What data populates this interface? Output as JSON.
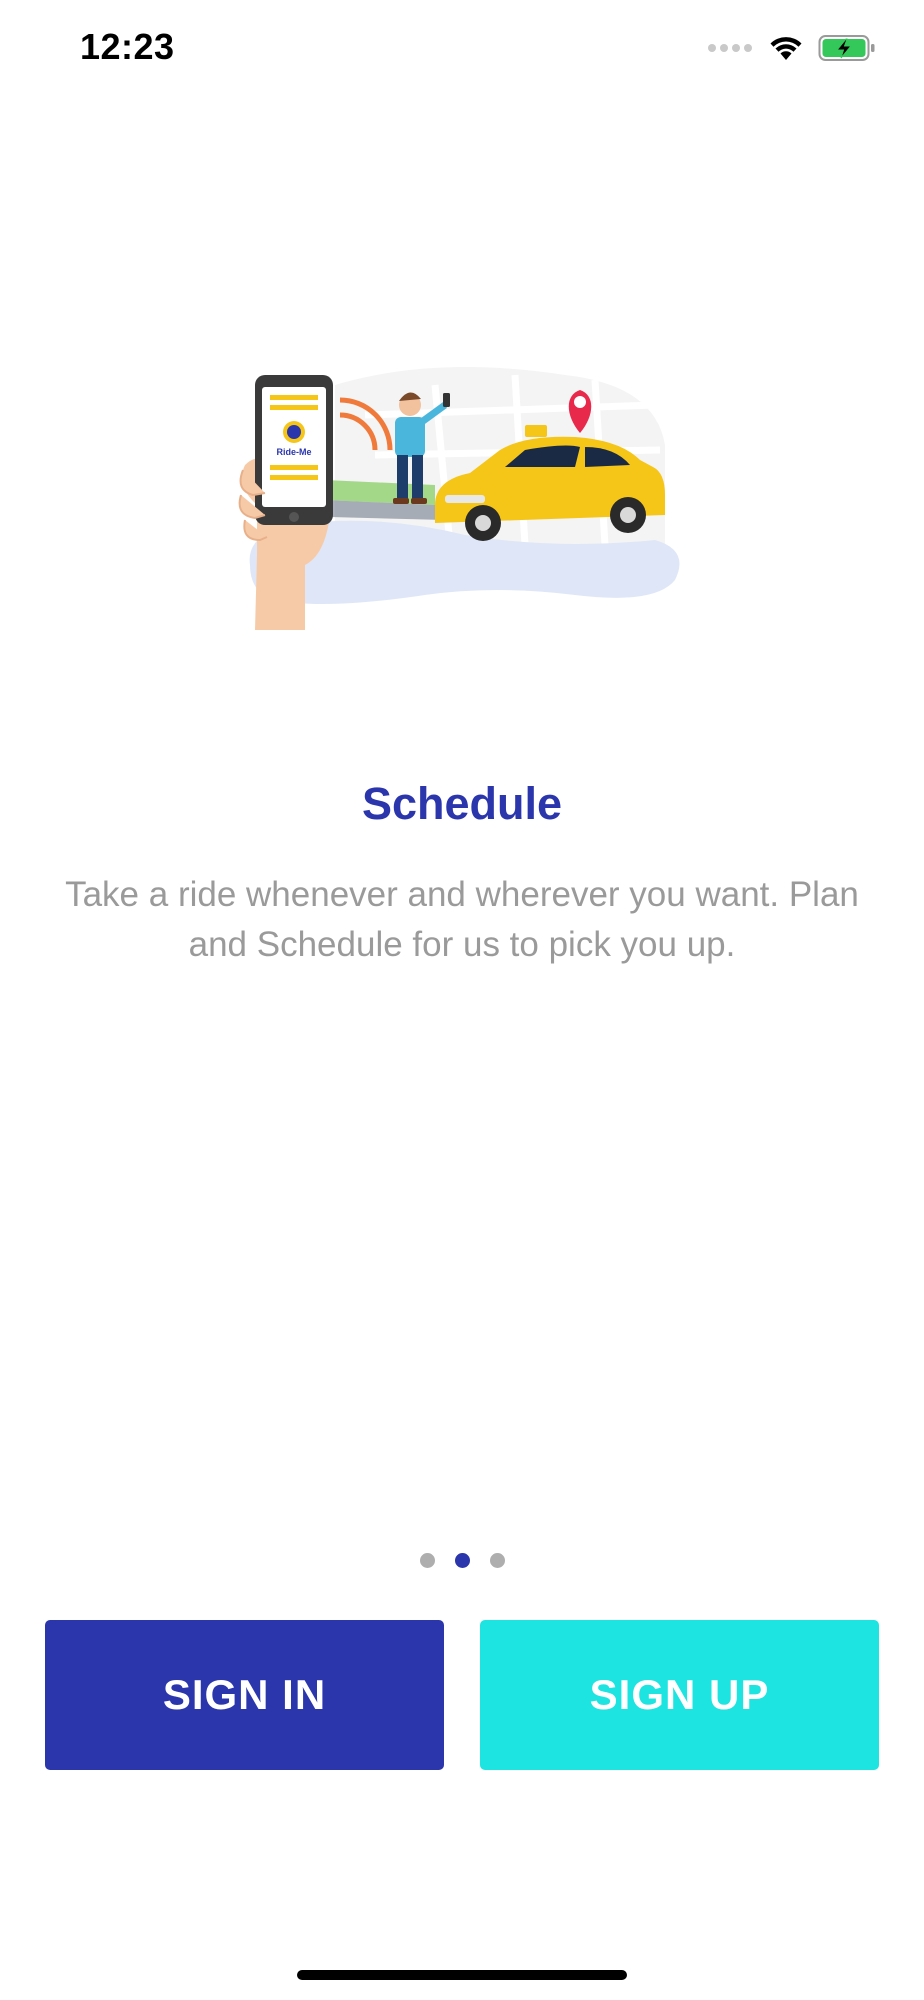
{
  "status_bar": {
    "time": "12:23"
  },
  "hero": {
    "phone_brand": "Ride-Me"
  },
  "onboarding": {
    "title": "Schedule",
    "description": "Take a ride whenever and wherever you want. Plan and Schedule for us to pick you up.",
    "page_count": 3,
    "active_page": 2
  },
  "actions": {
    "sign_in_label": "SIGN IN",
    "sign_up_label": "SIGN UP"
  },
  "colors": {
    "primary": "#2b36ad",
    "accent": "#1de4e0",
    "text_muted": "#9a9a9a",
    "dot_inactive": "#aeaeae",
    "taxi_yellow": "#f5c518",
    "battery_green": "#34c759"
  },
  "icons": {
    "signal": "cellular-signal-icon",
    "wifi": "wifi-icon",
    "battery": "battery-charging-icon",
    "pin": "location-pin-icon"
  }
}
